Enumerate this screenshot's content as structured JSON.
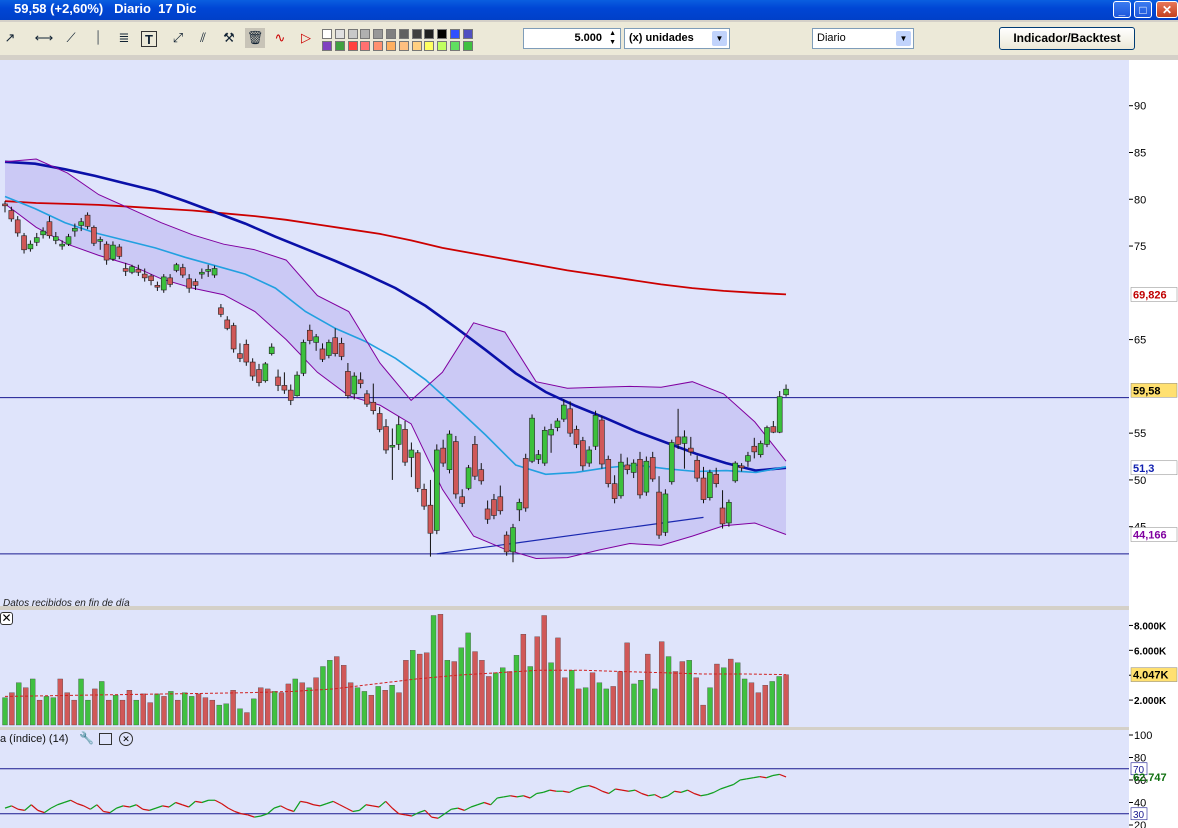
{
  "window": {
    "title": "59,58 (+2,60%)   Diario  17 Dic",
    "buttons": {
      "minimize": "_",
      "maximize": "□",
      "close": "✕"
    }
  },
  "toolbar": {
    "tools": [
      "pointer-icon",
      "line-icon",
      "horizontal-line-icon",
      "trendline-icon",
      "vertical-line-icon",
      "fibonacci-icon",
      "text-tool-icon",
      "channel-icon",
      "parallel-lines-icon",
      "hammer-icon",
      "trash-icon",
      "zigzag-icon",
      "triangle-icon"
    ],
    "palette": [
      "#ffffff",
      "#e0e0e0",
      "#c8c8c8",
      "#b0b0b0",
      "#989898",
      "#808080",
      "#606060",
      "#404040",
      "#202020",
      "#000000",
      "#3050ff",
      "#5050c0",
      "#8040c0",
      "#40a040",
      "#ff4040",
      "#ff7070",
      "#ff9070",
      "#ffb060",
      "#ffc080",
      "#ffd080",
      "#ffff60",
      "#c0ff60",
      "#60e060",
      "#40c040"
    ],
    "quantity": "5.000",
    "unit_label": "(x) unidades",
    "period": "Diario",
    "indicator_button": "Indicador/Backtest"
  },
  "chart_data": [
    {
      "type": "candlestick",
      "status_text": "Datos recibidos en fin de día",
      "ylim": [
        41,
        92
      ],
      "y_ticks": [
        90,
        85,
        80,
        75,
        65,
        55,
        50,
        45
      ],
      "price_labels": {
        "last": "59,58",
        "sma_long": "69,826",
        "sma_mid": "51,3",
        "band_low": "44,166"
      },
      "horizontal_levels": [
        58.8,
        42.1
      ],
      "trendline": {
        "from": [
          68,
          42.1
        ],
        "to": [
          110,
          46.0
        ]
      },
      "candles": [
        [
          79.5,
          79.8,
          78.6,
          79.3
        ],
        [
          78.8,
          79.2,
          77.6,
          77.9
        ],
        [
          77.8,
          78.2,
          76.0,
          76.4
        ],
        [
          76.1,
          76.4,
          74.2,
          74.6
        ],
        [
          74.7,
          75.6,
          74.4,
          75.2
        ],
        [
          75.4,
          76.4,
          75.0,
          75.9
        ],
        [
          76.2,
          77.0,
          75.8,
          76.6
        ],
        [
          77.6,
          78.2,
          75.8,
          76.1
        ],
        [
          75.6,
          76.5,
          75.2,
          76.0
        ],
        [
          75.0,
          75.6,
          74.6,
          75.2
        ],
        [
          75.2,
          76.3,
          75.0,
          76.0
        ],
        [
          76.6,
          77.4,
          76.0,
          76.9
        ],
        [
          77.2,
          78.0,
          76.6,
          77.6
        ],
        [
          78.3,
          78.6,
          76.8,
          77.1
        ],
        [
          77.0,
          77.2,
          75.0,
          75.3
        ],
        [
          75.5,
          76.0,
          74.6,
          75.7
        ],
        [
          75.2,
          75.5,
          73.0,
          73.5
        ],
        [
          73.6,
          75.5,
          73.4,
          75.1
        ],
        [
          74.9,
          75.2,
          73.6,
          73.9
        ],
        [
          72.6,
          73.2,
          71.8,
          72.3
        ],
        [
          72.2,
          73.0,
          72.0,
          72.8
        ],
        [
          72.5,
          73.0,
          71.8,
          72.2
        ],
        [
          72.0,
          72.6,
          71.2,
          71.6
        ],
        [
          71.8,
          72.0,
          70.8,
          71.3
        ],
        [
          70.8,
          71.2,
          70.2,
          70.6
        ],
        [
          70.3,
          72.0,
          70.0,
          71.7
        ],
        [
          71.6,
          72.0,
          70.6,
          70.9
        ],
        [
          72.4,
          73.2,
          72.2,
          73.0
        ],
        [
          72.7,
          73.1,
          71.6,
          71.9
        ],
        [
          71.5,
          72.0,
          70.0,
          70.5
        ],
        [
          71.2,
          71.5,
          70.3,
          70.8
        ],
        [
          72.0,
          72.6,
          71.5,
          72.2
        ],
        [
          72.3,
          73.0,
          71.7,
          72.5
        ],
        [
          71.9,
          72.9,
          71.6,
          72.6
        ],
        [
          68.4,
          68.8,
          67.4,
          67.7
        ],
        [
          67.1,
          67.5,
          66.0,
          66.2
        ],
        [
          66.5,
          66.8,
          63.6,
          64.0
        ],
        [
          63.5,
          64.6,
          62.6,
          63.0
        ],
        [
          64.5,
          65.0,
          62.2,
          62.6
        ],
        [
          62.6,
          63.0,
          60.6,
          61.1
        ],
        [
          61.8,
          62.4,
          60.0,
          60.4
        ],
        [
          60.6,
          62.6,
          60.4,
          62.4
        ],
        [
          63.5,
          64.6,
          63.3,
          64.2
        ],
        [
          61.0,
          61.8,
          59.5,
          60.1
        ],
        [
          60.1,
          61.5,
          59.2,
          59.6
        ],
        [
          59.6,
          60.2,
          58.0,
          58.5
        ],
        [
          59.0,
          61.6,
          58.9,
          61.2
        ],
        [
          61.4,
          65.0,
          61.1,
          64.7
        ],
        [
          66.0,
          66.6,
          64.5,
          64.9
        ],
        [
          64.7,
          65.6,
          63.8,
          65.3
        ],
        [
          64.0,
          64.6,
          62.6,
          62.9
        ],
        [
          63.3,
          65.0,
          63.0,
          64.7
        ],
        [
          65.2,
          66.2,
          63.2,
          63.5
        ],
        [
          64.6,
          65.2,
          62.8,
          63.2
        ],
        [
          61.6,
          62.5,
          58.7,
          59.0
        ],
        [
          59.2,
          61.5,
          58.6,
          61.1
        ],
        [
          60.7,
          61.5,
          59.8,
          60.3
        ],
        [
          59.2,
          59.6,
          57.8,
          58.1
        ],
        [
          58.3,
          60.3,
          57.0,
          57.4
        ],
        [
          57.1,
          57.8,
          55.1,
          55.4
        ],
        [
          55.7,
          56.5,
          52.8,
          53.2
        ],
        [
          53.5,
          55.5,
          50.0,
          53.7
        ],
        [
          53.8,
          56.8,
          53.2,
          55.9
        ],
        [
          55.4,
          56.3,
          51.5,
          51.9
        ],
        [
          52.4,
          54.0,
          50.3,
          53.2
        ],
        [
          52.9,
          53.2,
          48.7,
          49.1
        ],
        [
          49.0,
          49.6,
          46.8,
          47.2
        ],
        [
          47.3,
          50.0,
          41.8,
          44.3
        ],
        [
          44.6,
          53.8,
          44.2,
          53.2
        ],
        [
          53.4,
          54.3,
          51.4,
          51.8
        ],
        [
          51.1,
          55.3,
          50.7,
          54.9
        ],
        [
          54.1,
          54.7,
          48.0,
          48.5
        ],
        [
          48.2,
          49.0,
          47.1,
          47.5
        ],
        [
          49.1,
          51.6,
          48.9,
          51.3
        ],
        [
          53.8,
          54.7,
          50.0,
          50.4
        ],
        [
          51.1,
          51.8,
          49.5,
          49.9
        ],
        [
          46.9,
          47.8,
          45.3,
          45.8
        ],
        [
          47.9,
          48.5,
          45.8,
          46.2
        ],
        [
          48.2,
          49.4,
          46.3,
          46.7
        ],
        [
          44.1,
          44.5,
          41.9,
          42.3
        ],
        [
          42.3,
          45.3,
          41.2,
          44.9
        ],
        [
          46.8,
          48.0,
          45.6,
          47.6
        ],
        [
          52.3,
          52.8,
          46.6,
          47.0
        ],
        [
          52.0,
          57.0,
          51.8,
          56.6
        ],
        [
          52.2,
          53.2,
          51.7,
          52.7
        ],
        [
          51.8,
          55.7,
          51.5,
          55.3
        ],
        [
          54.8,
          56.0,
          52.9,
          55.4
        ],
        [
          55.6,
          56.6,
          55.2,
          56.3
        ],
        [
          56.5,
          58.6,
          56.2,
          58.0
        ],
        [
          57.6,
          58.4,
          54.6,
          55.0
        ],
        [
          55.4,
          55.8,
          53.4,
          53.8
        ],
        [
          54.2,
          54.6,
          51.0,
          51.5
        ],
        [
          51.8,
          53.6,
          51.4,
          53.2
        ],
        [
          53.6,
          57.4,
          53.2,
          56.9
        ],
        [
          56.4,
          56.8,
          51.2,
          51.7
        ],
        [
          52.2,
          52.6,
          49.2,
          49.6
        ],
        [
          49.6,
          50.5,
          47.5,
          48.0
        ],
        [
          48.3,
          52.8,
          48.0,
          51.9
        ],
        [
          51.6,
          52.4,
          50.6,
          51.1
        ],
        [
          50.8,
          52.2,
          50.2,
          51.8
        ],
        [
          52.2,
          53.0,
          48.0,
          48.4
        ],
        [
          48.7,
          52.5,
          48.3,
          52.0
        ],
        [
          52.4,
          53.0,
          49.8,
          50.1
        ],
        [
          48.7,
          50.4,
          43.7,
          44.1
        ],
        [
          44.4,
          49.0,
          44.0,
          48.5
        ],
        [
          49.8,
          54.3,
          49.5,
          54.0
        ],
        [
          54.6,
          57.6,
          53.3,
          53.8
        ],
        [
          53.9,
          55.3,
          51.2,
          54.6
        ],
        [
          53.4,
          54.6,
          52.6,
          53.0
        ],
        [
          52.1,
          52.6,
          49.8,
          50.2
        ],
        [
          50.2,
          51.4,
          47.5,
          47.9
        ],
        [
          48.1,
          51.1,
          47.8,
          50.8
        ],
        [
          50.6,
          51.3,
          49.2,
          49.6
        ],
        [
          47.0,
          48.9,
          44.8,
          45.3
        ],
        [
          45.4,
          47.9,
          45.0,
          47.6
        ],
        [
          49.9,
          52.0,
          49.7,
          51.8
        ],
        [
          51.5,
          51.8,
          50.9,
          51.3
        ],
        [
          52.0,
          53.0,
          51.4,
          52.6
        ],
        [
          53.6,
          54.5,
          52.3,
          53.0
        ],
        [
          52.7,
          54.2,
          52.4,
          53.9
        ],
        [
          53.8,
          55.8,
          53.5,
          55.6
        ],
        [
          55.7,
          56.3,
          55.0,
          55.1
        ],
        [
          55.1,
          59.5,
          55.0,
          58.9
        ],
        [
          59.1,
          60.2,
          58.9,
          59.7
        ]
      ],
      "series": [
        {
          "name": "",
          "color": "#cc0000",
          "values": [
            79.8,
            79.6,
            79.5,
            79.4,
            79.2,
            79.0,
            78.8,
            78.5,
            78.2,
            77.8,
            77.3,
            76.8,
            76.3,
            75.6,
            74.8,
            74.2,
            73.6,
            73.0,
            72.4,
            71.9,
            71.4,
            70.9,
            70.5,
            70.2,
            70.0,
            69.826
          ]
        },
        {
          "name": "",
          "color": "#0a10a8",
          "values": [
            84.0,
            83.8,
            83.2,
            82.5,
            81.7,
            80.9,
            79.8,
            78.6,
            77.4,
            76.0,
            74.7,
            73.4,
            72.0,
            70.5,
            68.6,
            66.3,
            63.9,
            61.4,
            59.4,
            57.9,
            56.6,
            55.2,
            54.0,
            52.8,
            51.8,
            51.0,
            51.3
          ]
        },
        {
          "name": "",
          "color": "#22a0e0",
          "values": [
            80.3,
            79.0,
            77.5,
            76.4,
            75.6,
            74.8,
            73.8,
            72.9,
            72.0,
            70.5,
            68.0,
            66.2,
            64.8,
            63.0,
            60.7,
            57.8,
            54.8,
            51.6,
            50.6,
            50.8,
            51.3,
            51.6,
            51.2,
            50.9,
            51.0,
            50.8,
            51.4
          ]
        },
        {
          "name": "",
          "color": "#8000a0",
          "values": [
            79.5,
            77.0,
            75.2,
            74.0,
            73.0,
            71.5,
            70.5,
            69.8,
            68.0,
            65.0,
            61.5,
            59.0,
            58.0,
            56.0,
            49.0,
            44.0,
            42.6,
            41.6,
            41.7,
            42.5,
            43.2,
            43.0,
            44.0,
            45.1,
            45.4,
            44.166
          ]
        },
        {
          "name": "",
          "color": "#8000a0",
          "values": [
            84.0,
            84.3,
            82.8,
            80.5,
            79.0,
            77.5,
            76.2,
            75.2,
            74.6,
            73.5,
            69.7,
            68.0,
            62.5,
            58.5,
            61.5,
            66.8,
            65.8,
            60.5,
            59.8,
            59.9,
            60.0,
            59.9,
            60.5,
            59.2,
            56.2,
            52.0
          ]
        }
      ]
    },
    {
      "type": "bar",
      "title": "",
      "y_ticks": [
        "8.000K",
        "6.000K",
        "4.000K",
        "2.000K"
      ],
      "ylim": [
        0,
        9000
      ],
      "last_label": "4.047K",
      "values": [
        2200,
        2600,
        3400,
        3000,
        3700,
        2000,
        2300,
        2200,
        3700,
        2600,
        2000,
        3700,
        2000,
        2900,
        3500,
        2000,
        2400,
        2000,
        2800,
        2000,
        2500,
        1800,
        2500,
        2300,
        2700,
        2000,
        2600,
        2300,
        2500,
        2200,
        2000,
        1600,
        1700,
        2800,
        1300,
        1000,
        2100,
        3000,
        2900,
        2700,
        2600,
        3300,
        3700,
        3400,
        3000,
        3800,
        4700,
        5200,
        5500,
        4800,
        3400,
        3000,
        2700,
        2400,
        3100,
        2800,
        3200,
        2600,
        5200,
        6000,
        5700,
        5800,
        8800,
        8900,
        5200,
        5100,
        6200,
        7400,
        5900,
        5200,
        3900,
        4200,
        4600,
        4300,
        5600,
        7300,
        4700,
        7100,
        8800,
        5000,
        7000,
        3800,
        4400,
        2900,
        3000,
        4200,
        3400,
        2900,
        3100,
        4300,
        6600,
        3300,
        3600,
        5700,
        2900,
        6700,
        5500,
        4300,
        5100,
        5200,
        3800,
        1600,
        3000,
        4900,
        4600,
        5300,
        5000,
        3700,
        3400,
        2600,
        3200,
        3500,
        3900,
        4047
      ],
      "series": [
        {
          "name": "",
          "values": [
            2300,
            2350,
            2400,
            2450,
            2500,
            2550,
            2600,
            2700,
            2900,
            3300,
            3700,
            4000,
            4200,
            4400,
            4400,
            4300,
            4200,
            4100,
            4100,
            4047
          ]
        }
      ]
    },
    {
      "type": "line",
      "title": "a (índice) (14)",
      "y_ticks": [
        "100",
        "80",
        "60",
        "40",
        "20"
      ],
      "ylim": [
        20,
        100
      ],
      "levels": {
        "upper": "70",
        "lower": "30"
      },
      "last_label": "62,747",
      "values": [
        35,
        37,
        34,
        33,
        38,
        33,
        31,
        35,
        38,
        40,
        42,
        39,
        37,
        34,
        38,
        32,
        31,
        35,
        37,
        36,
        38,
        34,
        33,
        35,
        37,
        36,
        40,
        38,
        36,
        41,
        40,
        42,
        42,
        39,
        35,
        32,
        30,
        29,
        27,
        28,
        30,
        35,
        37,
        34,
        32,
        41,
        40,
        38,
        37,
        39,
        41,
        38,
        35,
        32,
        33,
        38,
        37,
        36,
        41,
        35,
        30,
        29,
        28,
        31,
        33,
        27,
        26,
        30,
        34,
        35,
        33,
        36,
        38,
        40,
        38,
        44,
        45,
        46,
        45,
        46,
        44,
        48,
        49,
        51,
        50,
        50,
        49,
        52,
        54,
        55,
        53,
        50,
        48,
        52,
        51,
        50,
        51,
        48,
        46,
        47,
        44,
        46,
        50,
        49,
        51,
        48,
        46,
        47,
        49,
        52,
        54,
        56,
        60,
        61,
        62,
        63,
        62,
        64,
        65,
        62.7
      ]
    }
  ]
}
